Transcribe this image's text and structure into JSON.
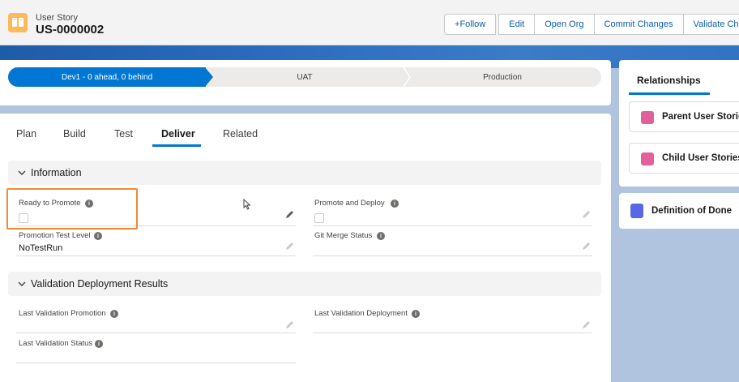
{
  "header": {
    "object_label": "User Story",
    "record_title": "US-0000002",
    "actions": {
      "follow": "Follow",
      "edit": "Edit",
      "open_org": "Open Org",
      "commit_changes": "Commit Changes",
      "validate_changes": "Validate Changes"
    }
  },
  "path": {
    "steps": [
      "Dev1 - 0 ahead, 0 behind",
      "UAT",
      "Production"
    ],
    "current_index": 0
  },
  "tabs": [
    "Plan",
    "Build",
    "Test",
    "Deliver",
    "Related"
  ],
  "active_tab": "Deliver",
  "sections": {
    "information": {
      "title": "Information",
      "fields": {
        "ready_to_promote": {
          "label": "Ready to Promote",
          "checked": false
        },
        "promote_and_deploy": {
          "label": "Promote and Deploy",
          "checked": false
        },
        "promotion_test_level": {
          "label": "Promotion Test Level",
          "value": "NoTestRun"
        },
        "git_merge_status": {
          "label": "Git Merge Status",
          "value": ""
        }
      }
    },
    "validation": {
      "title": "Validation Deployment Results",
      "fields": {
        "last_validation_promotion": {
          "label": "Last Validation Promotion",
          "value": ""
        },
        "last_validation_deployment": {
          "label": "Last Validation Deployment",
          "value": ""
        },
        "last_validation_status": {
          "label": "Last Validation Status",
          "value": ""
        }
      }
    }
  },
  "sidebar": {
    "tab": "Relationships",
    "tiles": [
      "Parent User Stories",
      "Child User Stories"
    ],
    "definition_of_done": "Definition of Done"
  },
  "colors": {
    "brand_blue": "#0176d3",
    "highlight_orange": "#f08a36",
    "object_icon": "#fcb95b",
    "tile_icon_pink": "#e3619a",
    "dod_icon_purple": "#5867e8"
  }
}
